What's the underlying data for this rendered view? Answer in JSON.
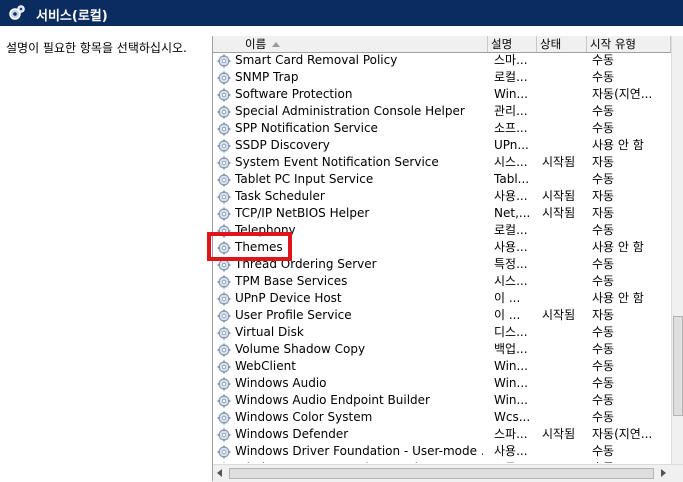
{
  "window": {
    "title": "서비스(로컬)",
    "icon": "gear-icon"
  },
  "sidebar": {
    "description": "설명이 필요한 항목을 선택하십시오."
  },
  "columns": {
    "name": "이름",
    "description": "설명",
    "status": "상태",
    "startup": "시작 유형"
  },
  "services": [
    {
      "name": "Smart Card Removal Policy",
      "description": "스마...",
      "status": "",
      "startup": "수동"
    },
    {
      "name": "SNMP Trap",
      "description": "로컬...",
      "status": "",
      "startup": "수동"
    },
    {
      "name": "Software Protection",
      "description": "Win...",
      "status": "",
      "startup": "자동(지연..."
    },
    {
      "name": "Special Administration Console Helper",
      "description": "관리...",
      "status": "",
      "startup": "수동"
    },
    {
      "name": "SPP Notification Service",
      "description": "소프...",
      "status": "",
      "startup": "수동"
    },
    {
      "name": "SSDP Discovery",
      "description": "UPn...",
      "status": "",
      "startup": "사용 안 함"
    },
    {
      "name": "System Event Notification Service",
      "description": "시스...",
      "status": "시작됨",
      "startup": "자동"
    },
    {
      "name": "Tablet PC Input Service",
      "description": "Tabl...",
      "status": "",
      "startup": "수동"
    },
    {
      "name": "Task Scheduler",
      "description": "사용...",
      "status": "시작됨",
      "startup": "자동"
    },
    {
      "name": "TCP/IP NetBIOS Helper",
      "description": "Net,...",
      "status": "시작됨",
      "startup": "자동"
    },
    {
      "name": "Telephony",
      "description": "로컬...",
      "status": "",
      "startup": "수동"
    },
    {
      "name": "Themes",
      "description": "사용...",
      "status": "",
      "startup": "사용 안 함"
    },
    {
      "name": "Thread Ordering Server",
      "description": "특정...",
      "status": "",
      "startup": "수동"
    },
    {
      "name": "TPM Base Services",
      "description": "시스...",
      "status": "",
      "startup": "수동"
    },
    {
      "name": "UPnP Device Host",
      "description": "이 ...",
      "status": "",
      "startup": "사용 안 함"
    },
    {
      "name": "User Profile Service",
      "description": "이 ...",
      "status": "시작됨",
      "startup": "자동"
    },
    {
      "name": "Virtual Disk",
      "description": "디스...",
      "status": "",
      "startup": "수동"
    },
    {
      "name": "Volume Shadow Copy",
      "description": "백업...",
      "status": "",
      "startup": "수동"
    },
    {
      "name": "WebClient",
      "description": "Win...",
      "status": "",
      "startup": "수동"
    },
    {
      "name": "Windows Audio",
      "description": "Win...",
      "status": "",
      "startup": "수동"
    },
    {
      "name": "Windows Audio Endpoint Builder",
      "description": "Win...",
      "status": "",
      "startup": "수동"
    },
    {
      "name": "Windows Color System",
      "description": "Wcs...",
      "status": "",
      "startup": "수동"
    },
    {
      "name": "Windows Defender",
      "description": "스파...",
      "status": "시작됨",
      "startup": "자동(지연..."
    },
    {
      "name": "Windows Driver Foundation - User-mode ...",
      "description": "사용...",
      "status": "",
      "startup": "수동"
    },
    {
      "name": "Windows Error Reporting Service",
      "description": "프로...",
      "status": "",
      "startup": "수동"
    }
  ],
  "highlighted_service": "Themes",
  "colors": {
    "titlebar": "#0b2c5f",
    "highlight": "#e0141b"
  }
}
